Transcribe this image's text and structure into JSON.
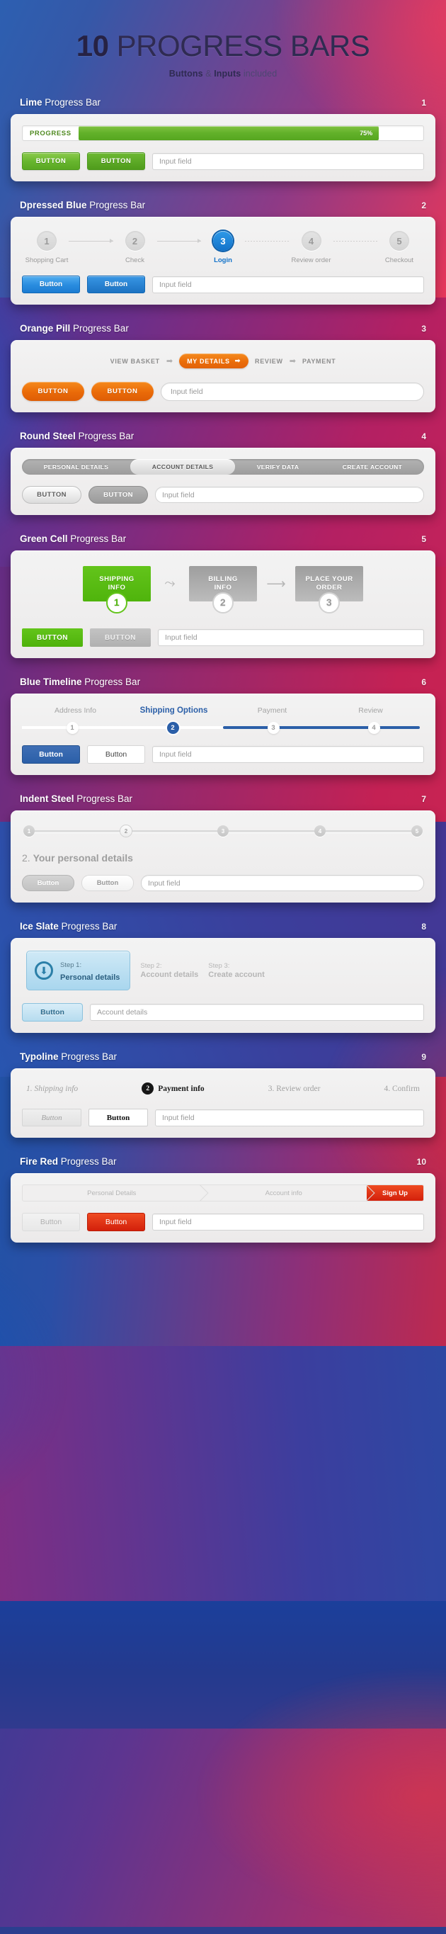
{
  "header": {
    "title_bold": "10",
    "title_rest": " PROGRESS BARS",
    "sub_b1": "Buttons",
    "sub_amp": " & ",
    "sub_b2": "Inputs",
    "sub_light": " included"
  },
  "common": {
    "progress_bar_suffix": " Progress Bar",
    "input_placeholder": "Input field"
  },
  "sections": [
    {
      "num": "1",
      "name_bold": "Lime",
      "name_rest": " Progress Bar",
      "progress_label": "PROGRESS",
      "percent_label": "75%",
      "percent_value": 75,
      "button1": "BUTTON",
      "button2": "BUTTON",
      "input_placeholder": "Input field"
    },
    {
      "num": "2",
      "name_bold": "Dpressed Blue",
      "name_rest": " Progress Bar",
      "steps": [
        {
          "number": "1",
          "label": "Shopping Cart",
          "active": false
        },
        {
          "number": "2",
          "label": "Check",
          "active": false
        },
        {
          "number": "3",
          "label": "Login",
          "active": true
        },
        {
          "number": "4",
          "label": "Review order",
          "active": false
        },
        {
          "number": "5",
          "label": "Checkout",
          "active": false
        }
      ],
      "button1": "Button",
      "button2": "Button",
      "input_placeholder": "Input field"
    },
    {
      "num": "3",
      "name_bold": "Orange Pill",
      "name_rest": " Progress Bar",
      "steps": [
        {
          "label": "VIEW BASKET",
          "active": false
        },
        {
          "label": "MY DETAILS",
          "active": true
        },
        {
          "label": "REVIEW",
          "active": false
        },
        {
          "label": "PAYMENT",
          "active": false
        }
      ],
      "button1": "BUTTON",
      "button2": "BUTTON",
      "input_placeholder": "Input field"
    },
    {
      "num": "4",
      "name_bold": "Round Steel",
      "name_rest": " Progress Bar",
      "steps": [
        {
          "label": "PERSONAL DETAILS",
          "active": false
        },
        {
          "label": "ACCOUNT DETAILS",
          "active": true
        },
        {
          "label": "VERIFY DATA",
          "active": false
        },
        {
          "label": "CREATE ACCOUNT",
          "active": false
        }
      ],
      "button1": "BUTTON",
      "button2": "BUTTON",
      "input_placeholder": "Input field"
    },
    {
      "num": "5",
      "name_bold": "Green Cell",
      "name_rest": " Progress Bar",
      "cells": [
        {
          "line1": "SHIPPING",
          "line2": "INFO",
          "badge": "1",
          "active": true
        },
        {
          "line1": "BILLING",
          "line2": "INFO",
          "badge": "2",
          "active": false
        },
        {
          "line1": "PLACE YOUR",
          "line2": "ORDER",
          "badge": "3",
          "active": false
        }
      ],
      "button1": "BUTTON",
      "button2": "BUTTON",
      "input_placeholder": "Input field"
    },
    {
      "num": "6",
      "name_bold": "Blue Timeline",
      "name_rest": " Progress Bar",
      "steps": [
        {
          "number": "1",
          "label": "Address Info",
          "active": false
        },
        {
          "number": "2",
          "label": "Shipping Options",
          "active": true
        },
        {
          "number": "3",
          "label": "Payment",
          "active": false
        },
        {
          "number": "4",
          "label": "Review",
          "active": false
        }
      ],
      "button1": "Button",
      "button2": "Button",
      "input_placeholder": "Input field"
    },
    {
      "num": "7",
      "name_bold": "Indent Steel",
      "name_rest": " Progress Bar",
      "nodes": [
        {
          "number": "1",
          "active": false
        },
        {
          "number": "2",
          "active": true
        },
        {
          "number": "3",
          "active": false
        },
        {
          "number": "4",
          "active": false
        },
        {
          "number": "5",
          "active": false
        }
      ],
      "heading_num": "2. ",
      "heading_text": "Your personal details",
      "button1": "Button",
      "button2": "Button",
      "input_placeholder": "Input field"
    },
    {
      "num": "8",
      "name_bold": "Ice Slate",
      "name_rest": " Progress Bar",
      "steps": [
        {
          "top": "Step 1:",
          "bottom": "Personal details",
          "active": true
        },
        {
          "top": "Step 2:",
          "bottom": "Account details",
          "active": false
        },
        {
          "top": "Step 3:",
          "bottom": "Create account",
          "active": false
        }
      ],
      "button1": "Button",
      "input_placeholder": "Account details"
    },
    {
      "num": "9",
      "name_bold": "Typoline",
      "name_rest": " Progress Bar",
      "steps": [
        {
          "number": "1.",
          "label": "Shipping info",
          "active": false
        },
        {
          "number": "2",
          "label": "Payment info",
          "active": true
        },
        {
          "number": "3.",
          "label": "Review order",
          "active": false
        },
        {
          "number": "4.",
          "label": "Confirm",
          "active": false
        }
      ],
      "button1": "Button",
      "button2": "Button",
      "input_placeholder": "Input field"
    },
    {
      "num": "10",
      "name_bold": "Fire Red",
      "name_rest": " Progress Bar",
      "steps": [
        {
          "label": "Personal Details",
          "active": false
        },
        {
          "label": "Account info",
          "active": false
        },
        {
          "label": "Sign Up",
          "active": true
        }
      ],
      "button1": "Button",
      "button2": "Button",
      "input_placeholder": "Input field"
    }
  ],
  "colors": {
    "lime": "#62b12a",
    "blue": "#1272c9",
    "orange": "#ea6d0a",
    "steel": "#9c9c9c",
    "green": "#4fb40c",
    "timeline_blue": "#2b5fa8",
    "indent_gray": "#c6c6c6",
    "ice": "#2b7fa8",
    "typo_black": "#161616",
    "fire_red": "#d3200b"
  }
}
